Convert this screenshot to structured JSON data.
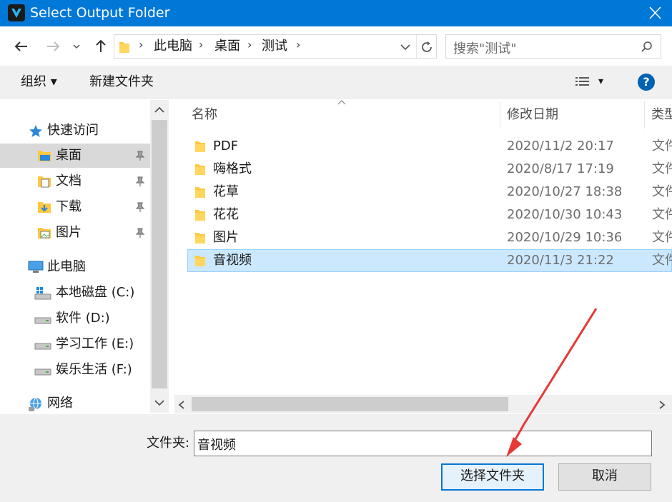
{
  "window": {
    "title": "Select Output Folder",
    "close_glyph": "✕"
  },
  "nav": {
    "back_glyph": "←",
    "forward_glyph": "→",
    "recent_glyph": "⌄",
    "up_glyph": "↑",
    "breadcrumb": [
      "此电脑",
      "桌面",
      "测试"
    ],
    "refresh_glyph": "↻"
  },
  "search": {
    "placeholder": "搜索\"测试\""
  },
  "toolbar": {
    "organize_label": "组织 ▾",
    "new_folder_label": "新建文件夹",
    "view_glyph": "▾",
    "help_glyph": "?"
  },
  "sidebar": {
    "quick_access": "快速访问",
    "items": [
      {
        "label": "桌面",
        "pinned": true,
        "selected": true
      },
      {
        "label": "文档",
        "pinned": true
      },
      {
        "label": "下载",
        "pinned": true
      },
      {
        "label": "图片",
        "pinned": true
      }
    ],
    "this_pc": "此电脑",
    "drives": [
      {
        "label": "本地磁盘 (C:)"
      },
      {
        "label": "软件 (D:)"
      },
      {
        "label": "学习工作 (E:)"
      },
      {
        "label": "娱乐生活 (F:)"
      }
    ],
    "network": "网络"
  },
  "files": {
    "columns": {
      "name": "名称",
      "date": "修改日期",
      "type": "类型"
    },
    "rows": [
      {
        "name": "PDF",
        "date": "2020/11/2 20:17",
        "type": "文件夹"
      },
      {
        "name": "嗨格式",
        "date": "2020/8/17 17:19",
        "type": "文件夹"
      },
      {
        "name": "花草",
        "date": "2020/10/27 18:38",
        "type": "文件夹"
      },
      {
        "name": "花花",
        "date": "2020/10/30 10:43",
        "type": "文件夹"
      },
      {
        "name": "图片",
        "date": "2020/10/29 10:36",
        "type": "文件夹"
      },
      {
        "name": "音视频",
        "date": "2020/11/3 21:22",
        "type": "文件夹",
        "selected": true
      }
    ]
  },
  "footer": {
    "folder_label": "文件夹:",
    "folder_value": "音视频",
    "select_button": "选择文件夹",
    "cancel_button": "取消"
  },
  "colors": {
    "accent": "#0078d7",
    "selection": "#cce8ff",
    "folder": "#ffc83d",
    "annotation_arrow": "#e53935"
  }
}
